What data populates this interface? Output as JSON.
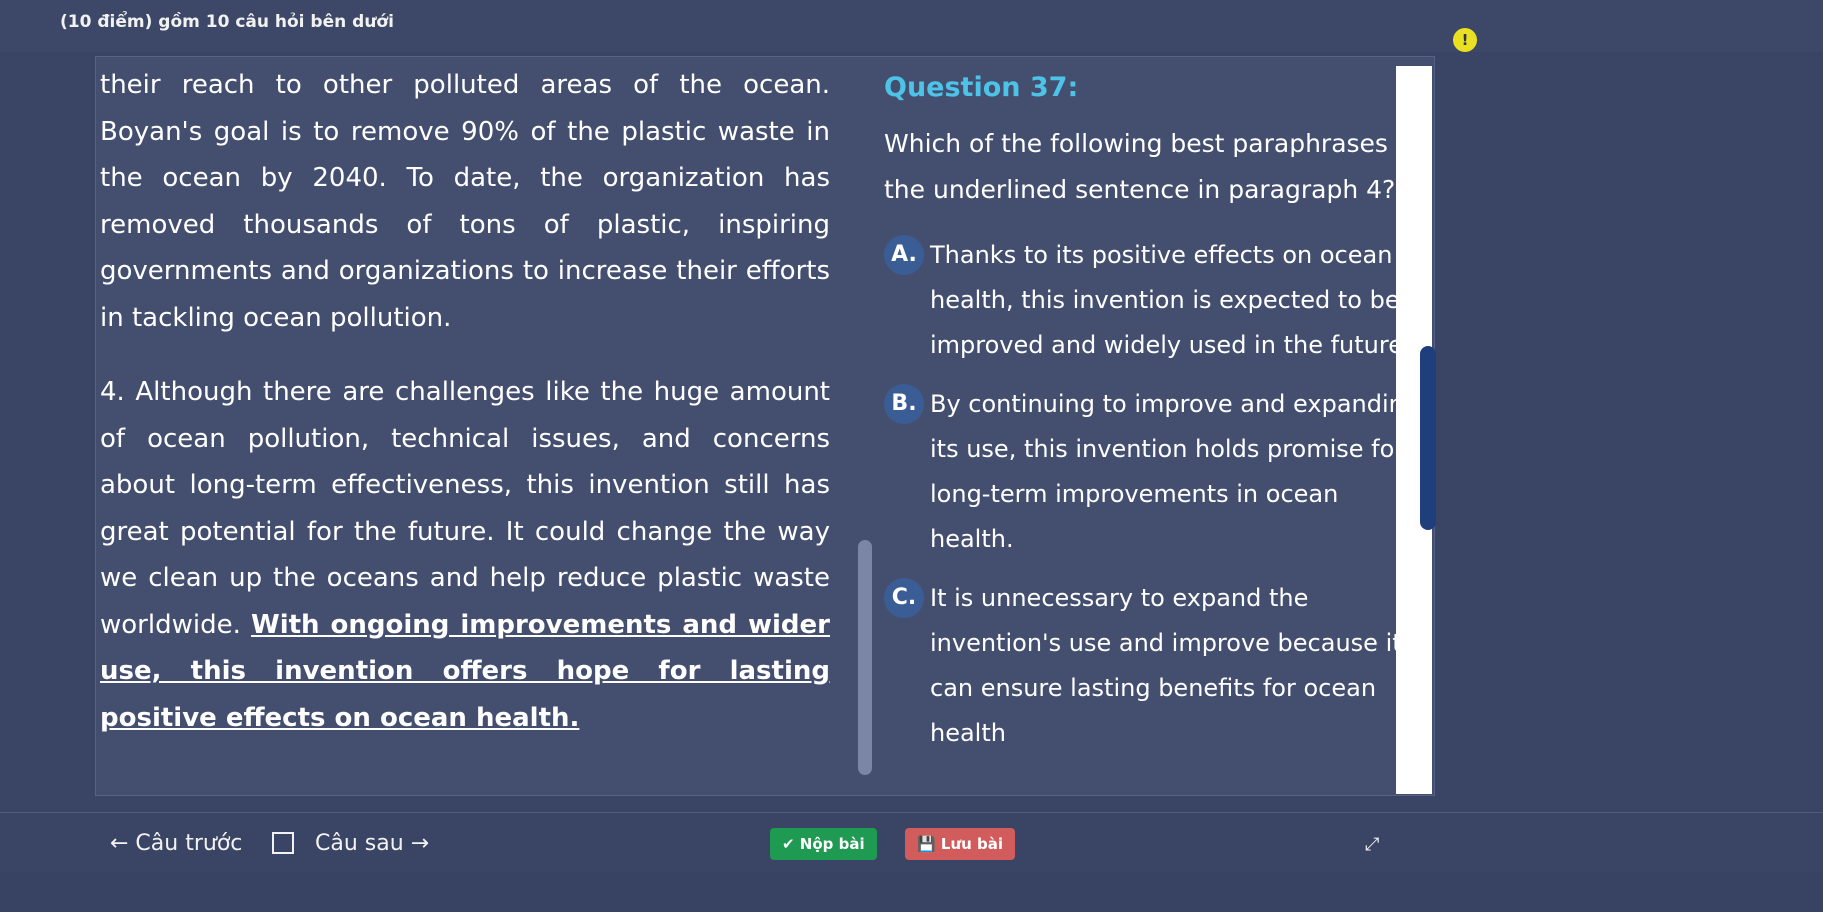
{
  "header": {
    "title": "(10 điểm) gồm 10 câu hỏi bên dưới",
    "info_icon": "!"
  },
  "passage": {
    "para1": "their reach to other polluted areas of the ocean. Boyan's goal is to remove 90% of the plastic waste in the ocean by 2040. To date, the organization has removed thousands of tons of plastic, inspiring governments and organizations to increase their efforts in tackling ocean pollution.",
    "para2_lead": "4. Although there are challenges like the huge amount of ocean pollution, technical issues, and concerns about long-term effectiveness, this invention still has great potential for the future. It could change the way we clean up the oceans and help reduce plastic waste worldwide.",
    "para2_underlined": "With ongoing improvements and wider use, this invention offers hope for lasting positive effects on ocean health."
  },
  "question": {
    "title": "Question 37:",
    "text": "Which of the following best paraphrases the underlined sentence in paragraph 4?",
    "options": [
      {
        "letter": "A.",
        "text": "Thanks to its positive effects on ocean health, this invention is expected to be improved and widely used in the future."
      },
      {
        "letter": "B.",
        "text": "By continuing to improve and expanding its use, this invention holds promise for long-term improvements in ocean health."
      },
      {
        "letter": "C.",
        "text": "It is unnecessary to expand the invention's use and improve because it can ensure lasting benefits for ocean health"
      }
    ]
  },
  "footer": {
    "prev_label": "← Câu trước",
    "next_label": "Câu sau →",
    "submit_label": "✔ Nộp bài",
    "save_label": "💾 Lưu bài",
    "expand_icon": "⤢"
  }
}
